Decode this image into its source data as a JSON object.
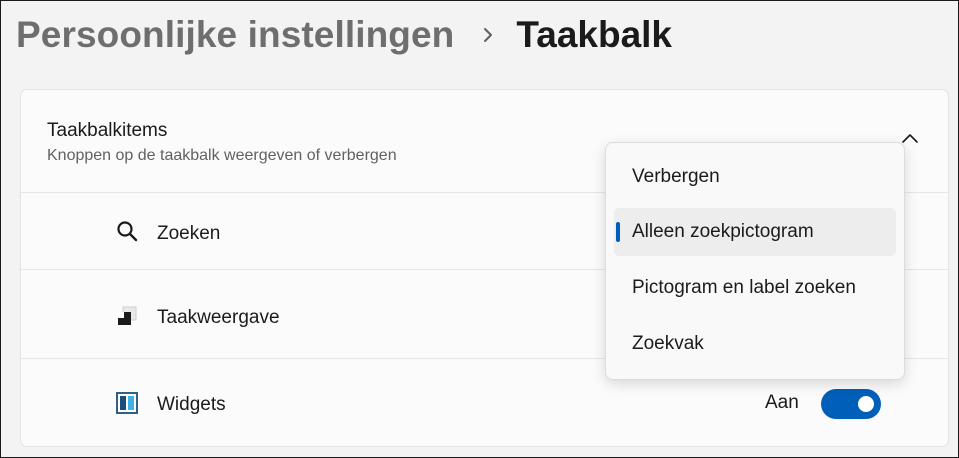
{
  "breadcrumb": {
    "parent": "Persoonlijke instellingen",
    "separator_icon": "chevron-right-icon",
    "current": "Taakbalk"
  },
  "card": {
    "title": "Taakbalkitems",
    "subtitle": "Knoppen op de taakbalk weergeven of verbergen",
    "collapse_icon": "chevron-up-icon"
  },
  "items": [
    {
      "label": "Zoeken",
      "icon": "search-icon"
    },
    {
      "label": "Taakweergave",
      "icon": "task-view-icon"
    },
    {
      "label": "Widgets",
      "icon": "widgets-icon",
      "toggle_label": "Aan",
      "toggle_on": true
    }
  ],
  "dropdown": {
    "options": [
      "Verbergen",
      "Alleen zoekpictogram",
      "Pictogram en label zoeken",
      "Zoekvak"
    ],
    "selected_index": 1
  },
  "colors": {
    "accent": "#005fb8",
    "background": "#f3f3f3",
    "card": "#fbfbfb",
    "breadcrumb_parent": "#6e6e6e"
  }
}
